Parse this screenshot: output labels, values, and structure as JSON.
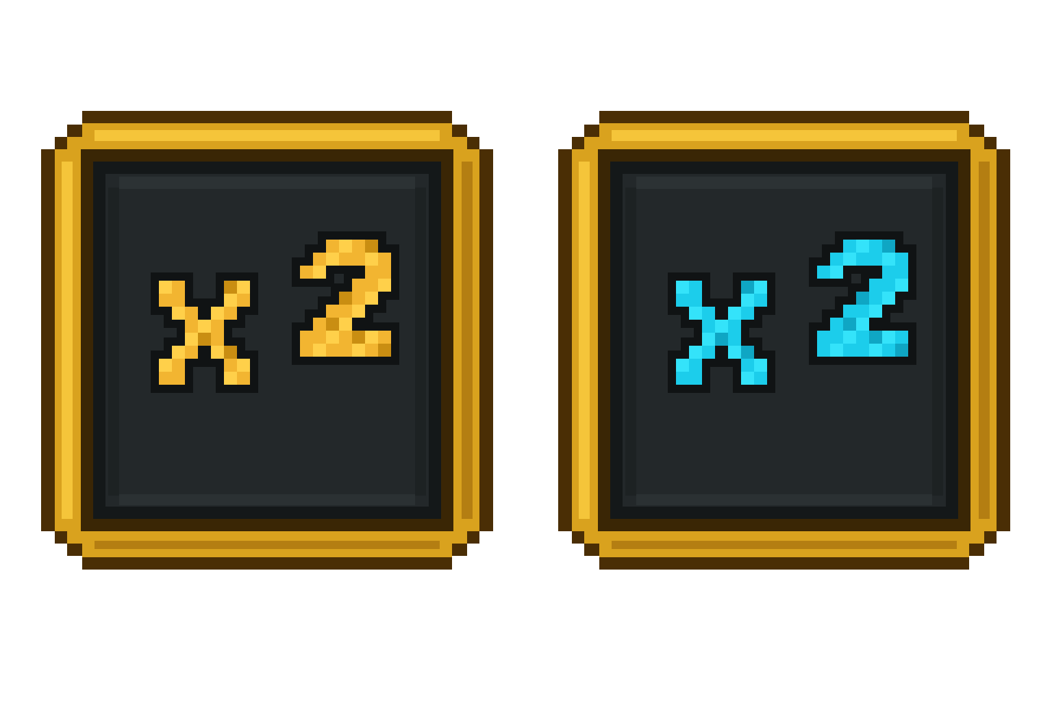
{
  "badges": [
    {
      "id": "gold",
      "label": "x2",
      "text_color": "#F2B531",
      "text_highlight": "#FFD04A",
      "text_shadow": "#C98E12",
      "frame_color": "#D9A21E",
      "frame_highlight": "#F5C53A",
      "frame_dark": "#4A2E05",
      "panel_color": "#23282A",
      "panel_dark": "#141819"
    },
    {
      "id": "cyan",
      "label": "x2",
      "text_color": "#1CCDEB",
      "text_highlight": "#34E3FA",
      "text_shadow": "#0FA6C4",
      "frame_color": "#D9A21E",
      "frame_highlight": "#F5C53A",
      "frame_dark": "#4A2E05",
      "panel_color": "#23282A",
      "panel_dark": "#141819"
    }
  ]
}
